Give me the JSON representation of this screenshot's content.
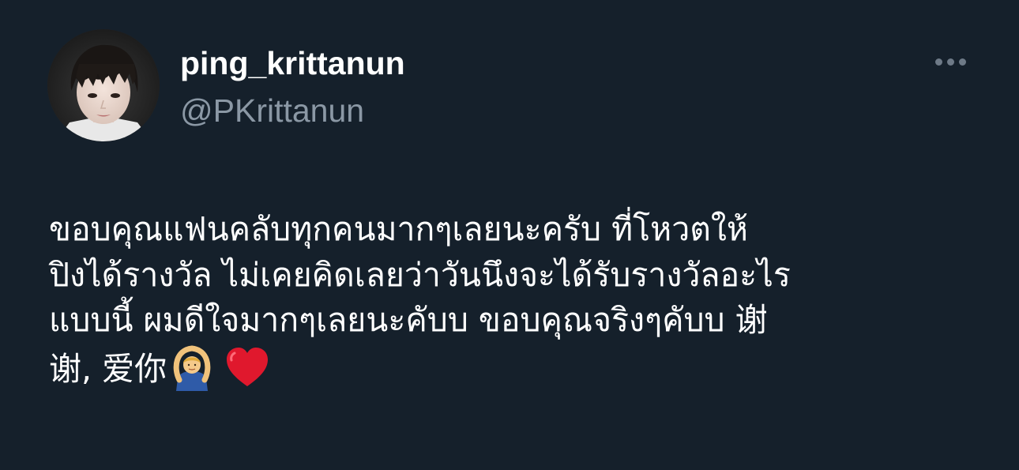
{
  "user": {
    "display_name": "ping_krittanun",
    "handle": "@PKrittanun"
  },
  "menu": {
    "icon": "more-horizontal-icon"
  },
  "tweet": {
    "lines": [
      "ขอบคุณแฟนคลับทุกคนมากๆเลยนะครับ ที่โหวตให้",
      "ปิงได้รางวัล ไม่เคยคิดเลยว่าวันนึงจะได้รับรางวัลอะไร",
      "แบบนี้ ผมดีใจมากๆเลยนะคับบ ขอบคุณจริงๆคับบ 谢",
      "谢, 爱你"
    ],
    "emojis": [
      "person-gesturing-ok-icon",
      "red-heart-icon"
    ]
  },
  "colors": {
    "background": "#15202b",
    "text": "#ffffff",
    "secondary": "#8b98a5"
  }
}
